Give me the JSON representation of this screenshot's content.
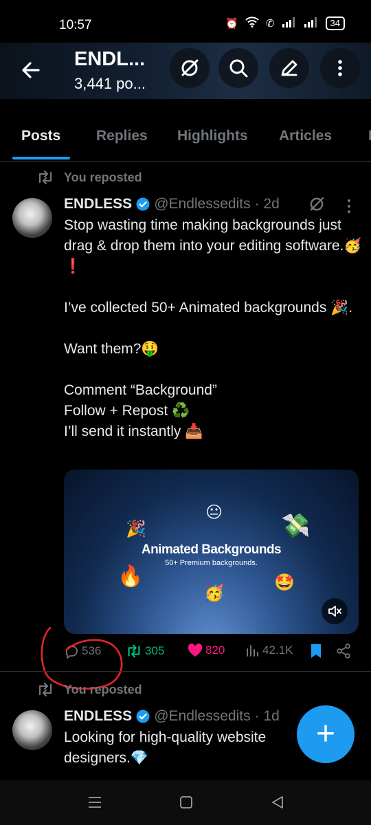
{
  "status_bar": {
    "time": "10:57",
    "battery": "34"
  },
  "header": {
    "title": "ENDL...",
    "subtitle": "3,441 po..."
  },
  "tabs": [
    {
      "label": "Posts"
    },
    {
      "label": "Replies"
    },
    {
      "label": "Highlights"
    },
    {
      "label": "Articles"
    },
    {
      "label": "I"
    }
  ],
  "posts": [
    {
      "repost_label": "You reposted",
      "name": "ENDLESS",
      "handle": "@Endlessedits",
      "time": "· 2d",
      "text": "Stop wasting time making backgrounds just drag & drop them into your editing software.🥳❗\n\nI’ve collected 50+ Animated backgrounds 🎉.\n\nWant them?🤑\n\nComment “Background”\nFollow + Repost ♻️\nI’ll send it instantly 📥",
      "media": {
        "title": "Animated Backgrounds",
        "subtitle": "50+ Premium backgrounds."
      },
      "stats": {
        "replies": "536",
        "reposts": "305",
        "likes": "820",
        "views": "42.1K"
      }
    },
    {
      "repost_label": "You reposted",
      "name": "ENDLESS",
      "handle": "@Endlessedits",
      "time": "· 1d",
      "text": "Looking for high-quality website designers.💎"
    }
  ],
  "fab": {
    "label": "+"
  },
  "colors": {
    "accent": "#1d9bf0",
    "repost_green": "#00ba7c",
    "like_pink": "#f91880",
    "annotation_red": "#e3262a"
  }
}
